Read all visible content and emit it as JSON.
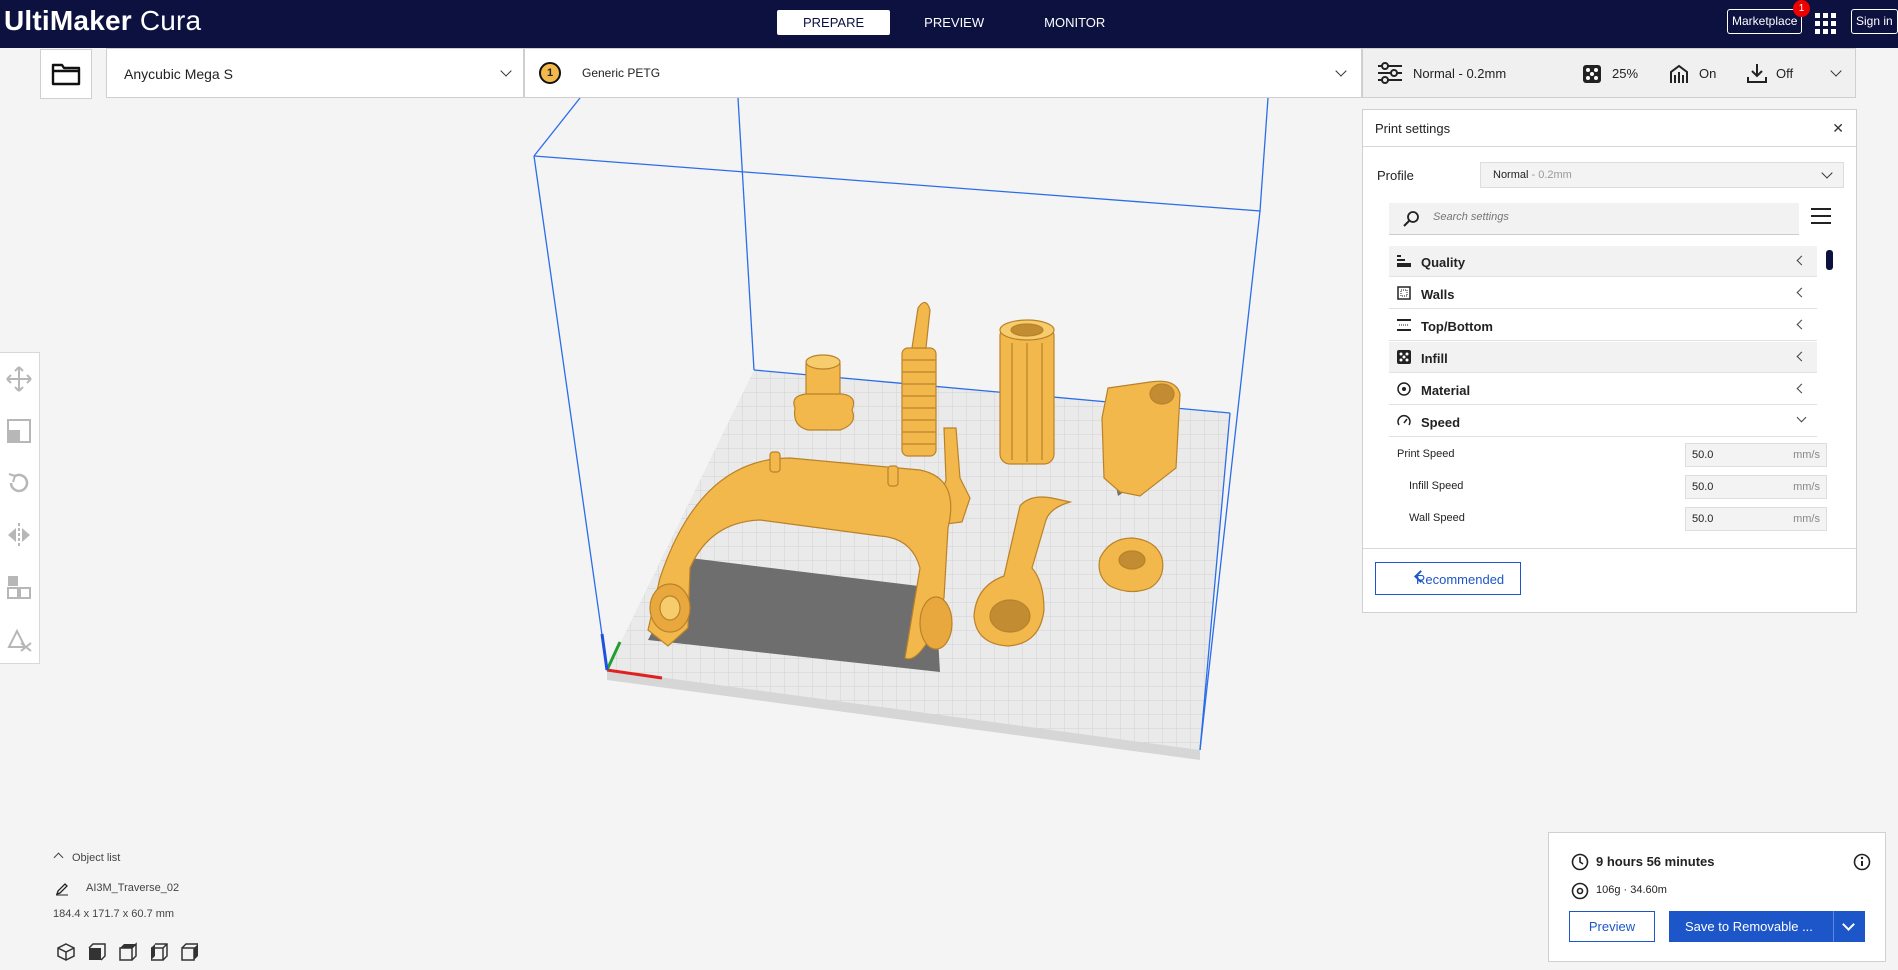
{
  "header": {
    "logo_bold": "UltiMaker",
    "logo_light": "Cura",
    "tabs": [
      {
        "label": "PREPARE",
        "active": true
      },
      {
        "label": "PREVIEW",
        "active": false
      },
      {
        "label": "MONITOR",
        "active": false
      }
    ],
    "marketplace_label": "Marketplace",
    "marketplace_badge": "1",
    "signin_label": "Sign in"
  },
  "topbar": {
    "printer": "Anycubic Mega S",
    "extruder_number": "1",
    "material": "Generic PETG",
    "profile": "Normal - 0.2mm",
    "infill": "25%",
    "support": "On",
    "adhesion": "Off"
  },
  "print_settings": {
    "title": "Print settings",
    "close_glyph": "✕",
    "profile_label": "Profile",
    "profile_name": "Normal",
    "profile_detail": " - 0.2mm",
    "search_placeholder": "Search settings",
    "categories": [
      {
        "label": "Quality",
        "icon": "quality-icon",
        "expanded": false
      },
      {
        "label": "Walls",
        "icon": "walls-icon",
        "expanded": false
      },
      {
        "label": "Top/Bottom",
        "icon": "top-bottom-icon",
        "expanded": false
      },
      {
        "label": "Infill",
        "icon": "infill-icon",
        "expanded": false
      },
      {
        "label": "Material",
        "icon": "material-icon",
        "expanded": false
      },
      {
        "label": "Speed",
        "icon": "speed-icon",
        "expanded": true
      }
    ],
    "settings": [
      {
        "label": "Print Speed",
        "value": "50.0",
        "unit": "mm/s"
      },
      {
        "label": "Infill Speed",
        "value": "50.0",
        "unit": "mm/s"
      },
      {
        "label": "Wall Speed",
        "value": "50.0",
        "unit": "mm/s"
      }
    ],
    "recommended_label": "Recommended"
  },
  "object_list": {
    "title": "Object list",
    "object_name": "AI3M_Traverse_02",
    "dimensions": "184.4 x 171.7 x 60.7 mm"
  },
  "action_panel": {
    "time": "9 hours 56 minutes",
    "material_usage": "106g · 34.60m",
    "preview_label": "Preview",
    "save_label": "Save to Removable ..."
  },
  "colors": {
    "header_bg": "#0c1140",
    "accent": "#1c56c8",
    "model": "#f2b84b"
  }
}
